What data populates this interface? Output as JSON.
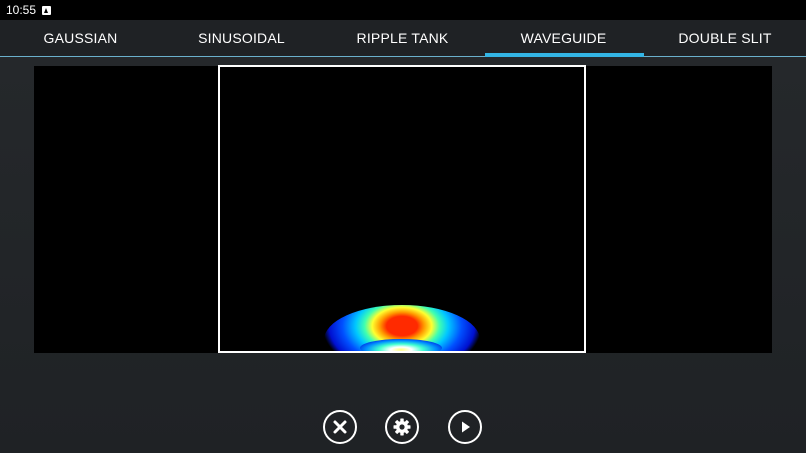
{
  "status_bar": {
    "time": "10:55",
    "notification_icon": "android-notification-icon"
  },
  "tabs": [
    {
      "label": "GAUSSIAN",
      "selected": false
    },
    {
      "label": "SINUSOIDAL",
      "selected": false
    },
    {
      "label": "RIPPLE TANK",
      "selected": false
    },
    {
      "label": "WAVEGUIDE",
      "selected": true
    },
    {
      "label": "DOUBLE SLIT",
      "selected": false
    }
  ],
  "colors": {
    "accent": "#33b5e5",
    "background": "#232629",
    "simulation_background": "#000000"
  },
  "controls": {
    "close_icon": "close-icon",
    "settings_icon": "gear-icon",
    "play_icon": "play-icon"
  }
}
